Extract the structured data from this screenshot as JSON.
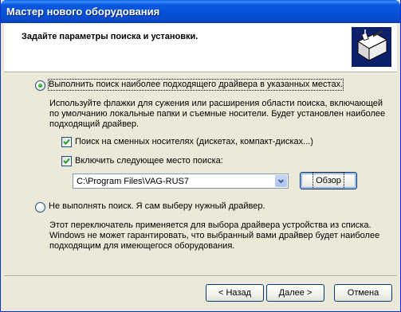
{
  "window": {
    "title": "Мастер нового оборудования"
  },
  "header": {
    "title": "Задайте параметры поиска и установки."
  },
  "option_search": {
    "label": "Выполнить поиск наиболее подходящего драйвера в указанных местах.",
    "selected": true,
    "description": [
      "Используйте флажки для сужения или расширения области поиска, включающей",
      "по умолчанию локальные папки и съемные носители. Будет установлен наиболее",
      "подходящий драйвер."
    ],
    "checkbox_removable": {
      "label": "Поиск на сменных носителях (дискетах, компакт-дисках...)",
      "checked": true
    },
    "checkbox_include": {
      "label": "Включить следующее место поиска:",
      "checked": true
    },
    "path": {
      "value": "C:\\Program Files\\VAG-RUS7"
    },
    "browse_label": "Обзор"
  },
  "option_manual": {
    "label": "Не выполнять поиск. Я сам выберу нужный драйвер.",
    "selected": false,
    "description": [
      "Этот переключатель применяется для выбора драйвера устройства из списка.",
      "Windows не может гарантировать, что выбранный вами драйвер будет наиболее",
      "подходящим для имеющегося оборудования."
    ]
  },
  "buttons": {
    "back": "< Назад",
    "next": "Далее >",
    "cancel": "Отмена"
  }
}
